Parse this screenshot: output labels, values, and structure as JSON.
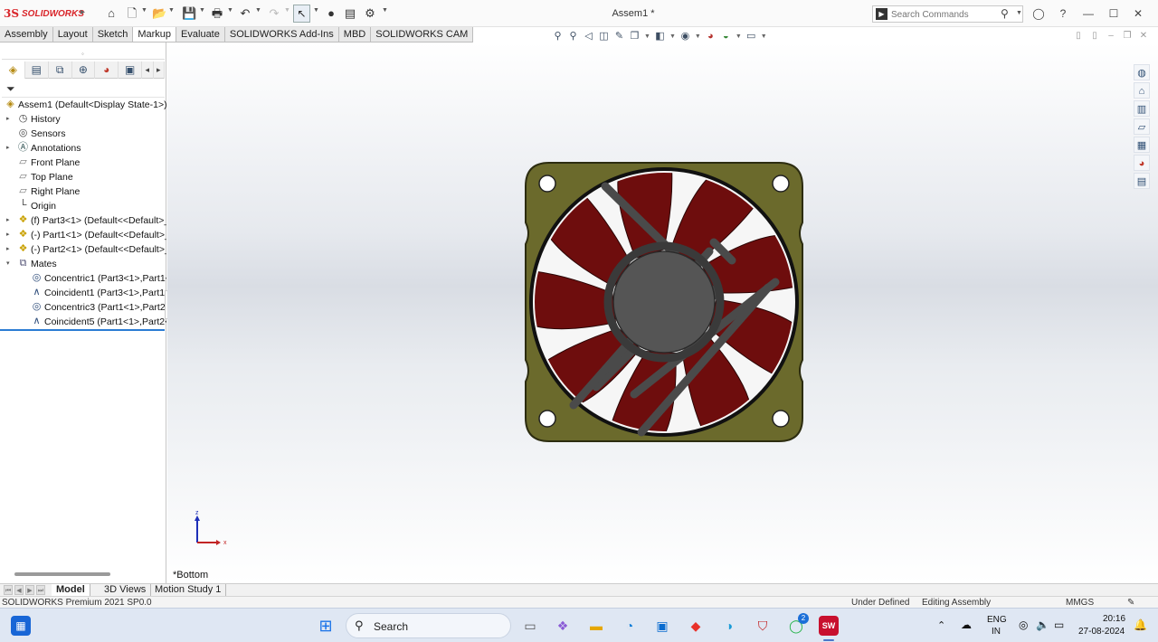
{
  "app": {
    "logo_mark": "3S",
    "logo_text": "SOLIDWORKS",
    "document_title": "Assem1 *"
  },
  "quick_access": {
    "icons": [
      "home-icon",
      "new-document-icon",
      "open-icon",
      "save-icon",
      "print-icon",
      "undo-icon",
      "redo-icon",
      "select-icon",
      "rebuild-icon",
      "file-properties-icon",
      "options-icon"
    ]
  },
  "search": {
    "placeholder": "Search Commands"
  },
  "command_tabs": [
    {
      "label": "Assembly",
      "active": false
    },
    {
      "label": "Layout",
      "active": false
    },
    {
      "label": "Sketch",
      "active": false
    },
    {
      "label": "Markup",
      "active": true
    },
    {
      "label": "Evaluate",
      "active": false
    },
    {
      "label": "SOLIDWORKS Add-Ins",
      "active": false
    },
    {
      "label": "MBD",
      "active": false
    },
    {
      "label": "SOLIDWORKS CAM",
      "active": false
    }
  ],
  "feature_tree": {
    "rows": [
      {
        "label": "Assem1  (Default<Display State-1>)",
        "icon": "assembly-icon",
        "expander": false,
        "indent": 0
      },
      {
        "label": "History",
        "icon": "history-icon",
        "expander": true,
        "indent": 1
      },
      {
        "label": "Sensors",
        "icon": "sensor-icon",
        "expander": false,
        "indent": 1
      },
      {
        "label": "Annotations",
        "icon": "annotations-icon",
        "expander": true,
        "indent": 1
      },
      {
        "label": "Front Plane",
        "icon": "plane-icon",
        "expander": false,
        "indent": 1
      },
      {
        "label": "Top Plane",
        "icon": "plane-icon",
        "expander": false,
        "indent": 1
      },
      {
        "label": "Right Plane",
        "icon": "plane-icon",
        "expander": false,
        "indent": 1
      },
      {
        "label": "Origin",
        "icon": "origin-icon",
        "expander": false,
        "indent": 1
      },
      {
        "label": "(f) Part3<1> (Default<<Default>_",
        "icon": "part-icon",
        "expander": true,
        "indent": 1
      },
      {
        "label": "(-) Part1<1> (Default<<Default>_",
        "icon": "part-icon",
        "expander": true,
        "indent": 1
      },
      {
        "label": "(-) Part2<1> (Default<<Default>_",
        "icon": "part-icon",
        "expander": true,
        "indent": 1
      },
      {
        "label": "Mates",
        "icon": "mates-icon",
        "expander": true,
        "expanded": true,
        "indent": 1
      },
      {
        "label": "Concentric1 (Part3<1>,Part1<",
        "icon": "concentric-icon",
        "expander": false,
        "indent": 2
      },
      {
        "label": "Coincident1 (Part3<1>,Part1<",
        "icon": "coincident-icon",
        "expander": false,
        "indent": 2
      },
      {
        "label": "Concentric3 (Part1<1>,Part2<",
        "icon": "concentric-icon",
        "expander": false,
        "indent": 2
      },
      {
        "label": "Coincident5 (Part1<1>,Part2<",
        "icon": "coincident-icon",
        "expander": false,
        "indent": 2
      }
    ]
  },
  "viewport": {
    "view_label": "*Bottom",
    "triad": {
      "z": "z",
      "x": "x"
    },
    "colors": {
      "frame": "#6b6a2c",
      "blade": "#6e0d0d",
      "hub": "#555555",
      "strut": "#4a4a4a"
    }
  },
  "bottom_tabs": [
    {
      "label": "Model",
      "active": true
    },
    {
      "label": "3D Views",
      "active": false
    },
    {
      "label": "Motion Study 1",
      "active": false
    }
  ],
  "status_bar": {
    "product": "SOLIDWORKS Premium 2021 SP0.0",
    "definition": "Under Defined",
    "mode": "Editing Assembly",
    "units": "MMGS"
  },
  "taskbar": {
    "search_label": "Search",
    "language_top": "ENG",
    "language_bottom": "IN",
    "time": "20:16",
    "date": "27-08-2024",
    "whatsapp_badge": "2"
  }
}
